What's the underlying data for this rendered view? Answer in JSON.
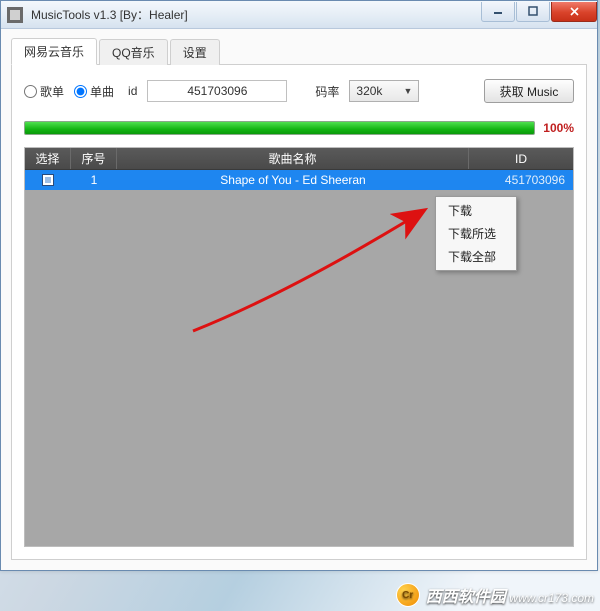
{
  "window": {
    "title": "MusicTools v1.3 [By：Healer]"
  },
  "tabs": {
    "items": [
      {
        "label": "网易云音乐"
      },
      {
        "label": "QQ音乐"
      },
      {
        "label": "设置"
      }
    ],
    "active_index": 0
  },
  "search": {
    "radio_playlist_label": "歌单",
    "radio_single_label": "单曲",
    "radio_selected": "single",
    "id_label": "id",
    "id_value": "451703096",
    "rate_label": "码率",
    "rate_selected": "320k",
    "fetch_button_label": "获取 Music"
  },
  "progress": {
    "percent_label": "100%"
  },
  "grid": {
    "columns": {
      "select": "选择",
      "index": "序号",
      "name": "歌曲名称",
      "id": "ID"
    },
    "rows": [
      {
        "checked": true,
        "index": "1",
        "name": "Shape of You - Ed Sheeran",
        "id": "451703096"
      }
    ]
  },
  "context_menu": {
    "items": [
      {
        "label": "下载"
      },
      {
        "label": "下载所选"
      },
      {
        "label": "下载全部"
      }
    ]
  },
  "watermark": {
    "brand": "西西软件园",
    "url": "www.cr173.com"
  }
}
